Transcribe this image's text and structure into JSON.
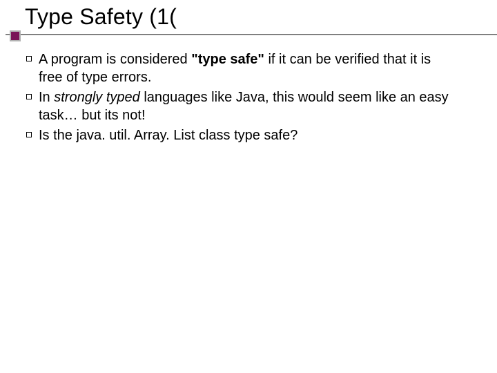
{
  "title": "Type Safety (1(",
  "bullets": [
    {
      "pre": "A program is considered ",
      "em": "\"type safe\"",
      "em_style": "bold",
      "post": " if it can be verified that it is free of type errors."
    },
    {
      "pre": "In ",
      "em": "strongly typed",
      "em_style": "ital",
      "post": " languages like Java, this would seem like an easy task… but its not!"
    },
    {
      "pre": "Is the java. util. Array. List class type safe?",
      "em": "",
      "em_style": "",
      "post": ""
    }
  ]
}
